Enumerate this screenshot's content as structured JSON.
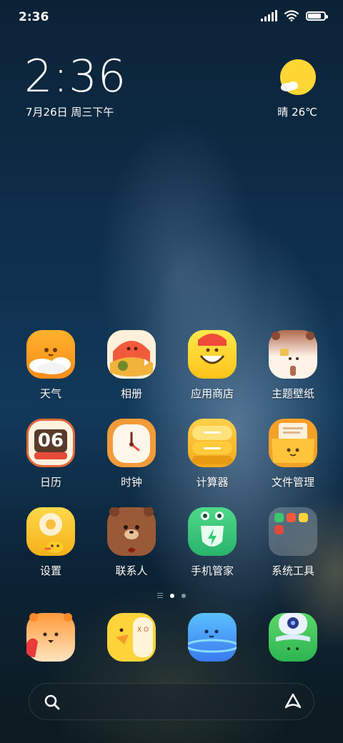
{
  "status_bar": {
    "time": "2:36",
    "battery_level": 0.9
  },
  "lock_clock": {
    "time": "2:36",
    "date": "7月26日 周三下午"
  },
  "weather": {
    "text": "晴 26℃",
    "icon": "sun-cloud-icon"
  },
  "apps_row1": [
    {
      "label": "天气",
      "icon": "weather-app-icon"
    },
    {
      "label": "相册",
      "icon": "gallery-app-icon"
    },
    {
      "label": "应用商店",
      "icon": "app-store-icon"
    },
    {
      "label": "主题壁纸",
      "icon": "themes-icon"
    }
  ],
  "apps_row2": [
    {
      "label": "日历",
      "icon": "calendar-icon",
      "badge": "06"
    },
    {
      "label": "时钟",
      "icon": "clock-app-icon"
    },
    {
      "label": "计算器",
      "icon": "calculator-icon"
    },
    {
      "label": "文件管理",
      "icon": "file-manager-icon"
    }
  ],
  "apps_row3": [
    {
      "label": "设置",
      "icon": "settings-icon"
    },
    {
      "label": "联系人",
      "icon": "contacts-icon"
    },
    {
      "label": "手机管家",
      "icon": "security-app-icon"
    },
    {
      "label": "系统工具",
      "icon": "system-tools-folder-icon"
    }
  ],
  "page_indicator": {
    "pages": 2,
    "current": 1
  },
  "dock": [
    {
      "icon": "phone-app-icon"
    },
    {
      "icon": "messaging-app-icon"
    },
    {
      "icon": "browser-app-icon"
    },
    {
      "icon": "camera-app-icon"
    }
  ],
  "search": {
    "icon": "search-icon",
    "assistant_icon": "assistant-icon"
  },
  "colors": {
    "accent_yellow": "#FFD23C",
    "sun": "#FFD633"
  }
}
